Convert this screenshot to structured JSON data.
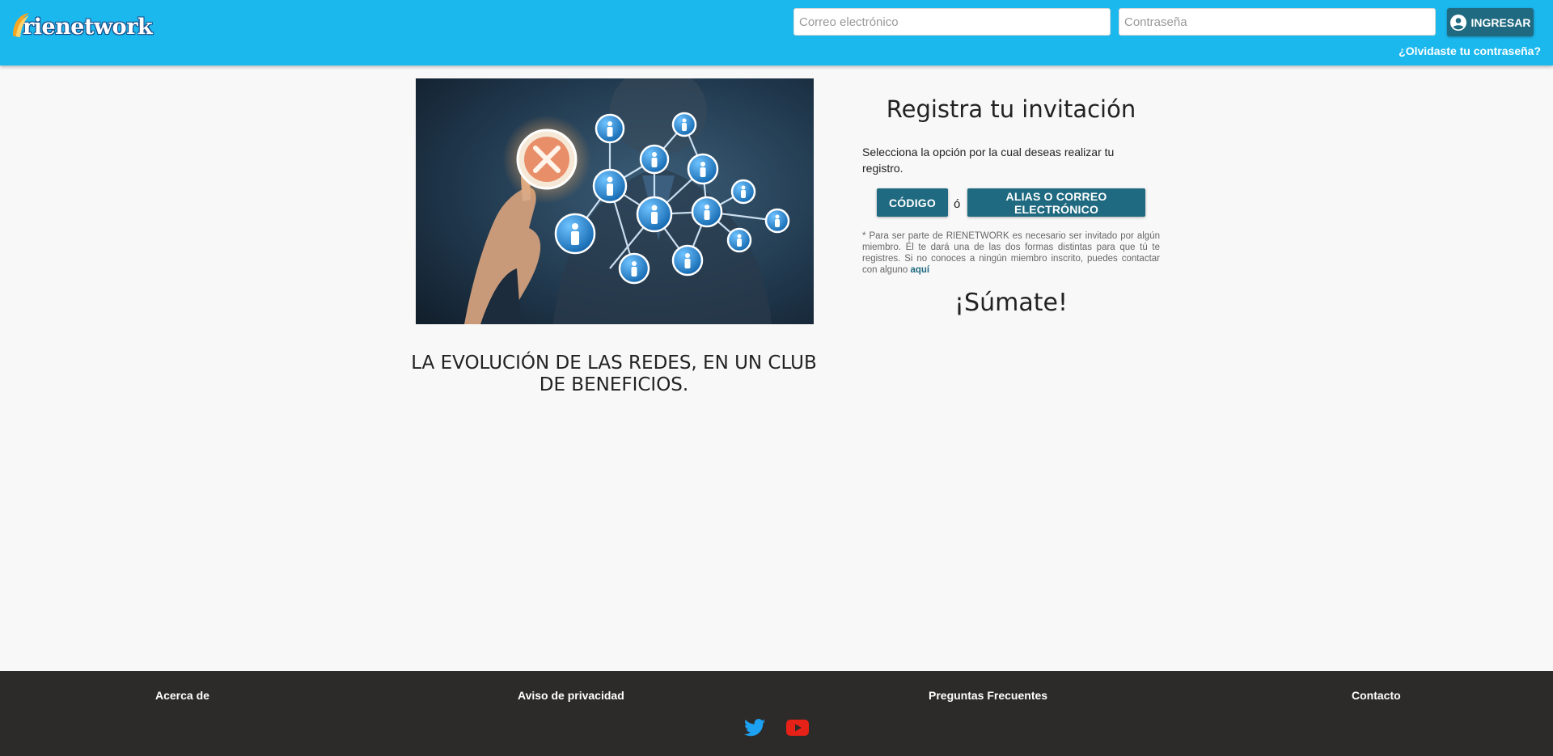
{
  "header": {
    "logo_text": "rienetwork",
    "email_placeholder": "Correo electrónico",
    "password_placeholder": "Contraseña",
    "login_label": "INGRESAR",
    "forgot_label": "¿Olvidaste tu contraseña?"
  },
  "hero": {
    "tagline": "LA EVOLUCIÓN DE LAS REDES, EN UN CLUB DE BENEFICIOS."
  },
  "register": {
    "title": "Registra tu invitación",
    "instructions": "Selecciona la opción por la cual deseas realizar tu registro.",
    "code_button": "CÓDIGO",
    "or_text": "ó",
    "alias_button": "ALIAS O CORREO ELECTRÓNICO",
    "note": "* Para ser parte de RIENETWORK es necesario ser invitado por algún miembro. Él te dará una de las dos formas distintas para que tú te registres. Si no conoces a ningún miembro inscrito, puedes contactar con alguno",
    "note_link": "aquí",
    "join": "¡Súmate!"
  },
  "footer": {
    "about": "Acerca de",
    "privacy": "Aviso de privacidad",
    "faq": "Preguntas Frecuentes",
    "contact": "Contacto",
    "social": [
      "twitter-icon",
      "youtube-icon"
    ]
  },
  "colors": {
    "header_bg": "#1bb8ee",
    "button_bg": "#1f6a80",
    "footer_bg": "#2d2b2a",
    "twitter": "#1da1f2",
    "youtube": "#e62117"
  }
}
